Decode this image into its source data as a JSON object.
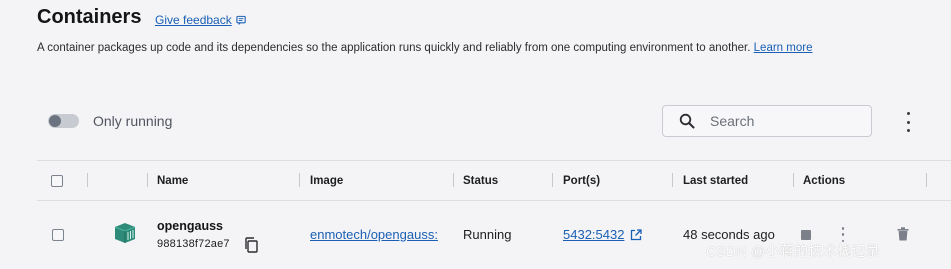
{
  "header": {
    "title": "Containers",
    "feedback_label": "Give feedback",
    "description": "A container packages up code and its dependencies so the application runs quickly and reliably from one computing environment to another.",
    "learn_more": "Learn more"
  },
  "toolbar": {
    "only_running_label": "Only running",
    "only_running_on": false,
    "search_placeholder": "Search"
  },
  "table": {
    "columns": [
      "Name",
      "Image",
      "Status",
      "Port(s)",
      "Last started",
      "Actions"
    ],
    "rows": [
      {
        "name": "opengauss",
        "id": "988138f72ae7",
        "image": "enmotech/opengauss:",
        "status": "Running",
        "ports": "5432:5432",
        "last_started": "48 seconds ago"
      }
    ]
  },
  "watermark": "CSDN @小蒋的技术栈记录",
  "colors": {
    "link": "#1a5fb4",
    "container_icon": "#2e8b7a",
    "background": "#f4f4f6"
  },
  "icons": [
    "feedback-icon",
    "search-icon",
    "more-vert-icon",
    "container-icon",
    "copy-icon",
    "external-link-icon",
    "stop-icon",
    "trash-icon"
  ]
}
